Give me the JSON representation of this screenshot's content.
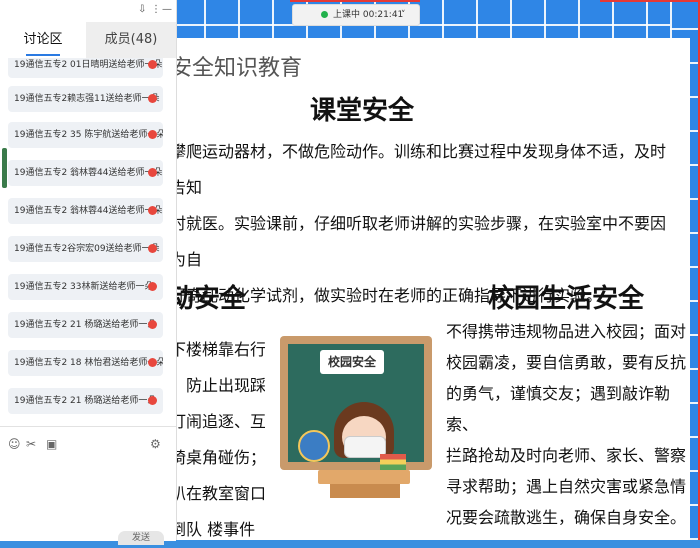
{
  "colors": {
    "accent": "#2a7ae2",
    "background_blue": "#2f86e6",
    "live_dot": "#22b14c",
    "alert": "#e53935"
  },
  "status": {
    "text": "上课中 00:21:41",
    "chevron": "˅"
  },
  "panel": {
    "toolbar_icons": [
      "pin-icon",
      "more-icon",
      "minimize-icon"
    ],
    "tabs": [
      {
        "label": "讨论区"
      },
      {
        "label": "成员(48)"
      }
    ],
    "messages": [
      "19通信五专2 01日晴明送给老师一朵",
      "19通信五专2赖志强11送给老师一朵",
      "19通信五专2 35 陈宇航送给老师一朵",
      "19通信五专2 翁林蓉44送给老师一朵",
      "19通信五专2 翁林蓉44送给老师一朵",
      "19通信五专2谷宗宏09送给老师一朵",
      "19通信五专2 33林新送给老师一朵",
      "19通信五专2 21 杨璐送给老师一朵",
      "19通信五专2 18 林怡君送给老师一朵",
      "19通信五专2 21 杨璐送给老师一朵"
    ],
    "input_tools": [
      "emoji-icon",
      "scissors-icon",
      "image-icon",
      "settings-icon"
    ],
    "send_label": "发送"
  },
  "slide": {
    "title": "安全知识教育",
    "section1_heading": "课堂安全",
    "section1_lines": [
      "攀爬运动器材，不做危险动作。训练和比赛过程中发现身体不适，及时告知",
      "时就医。实验课前，仔细听取老师讲解的实验步骤，在实验室中不要因为自",
      "好奇乱动化学试剂，做实验时在老师的正确指导下进行实验。"
    ],
    "section2_heading": "动安全",
    "section2_lines": [
      "下楼梯靠右行，",
      "，防止出现踩",
      "打闹追逐、互",
      "椅桌角碰伤；",
      "趴在教室窗口",
      "倒队 楼事件"
    ],
    "board_label": "校园安全",
    "section3_heading": "校园生活安全",
    "section3_lines": [
      "不得携带违规物品进入校园；面对",
      "校园霸凌，要自信勇敢，要有反抗",
      "的勇气，谨慎交友；遇到敲诈勒索、",
      "拦路抢劫及时向老师、家长、警察",
      "寻求帮助；遇上自然灾害或紧急情",
      "况要会疏散逃生，确保自身安全。"
    ]
  }
}
